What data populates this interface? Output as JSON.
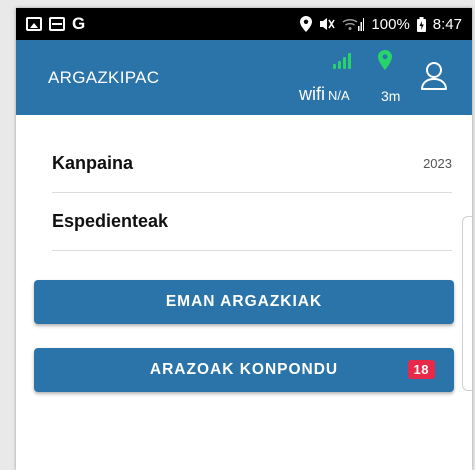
{
  "status_bar": {
    "left_icons": [
      "image-icon",
      "card-icon"
    ],
    "g_label": "G",
    "battery": "100%",
    "time": "8:47"
  },
  "header": {
    "app_title": "ARGAZKIPAC",
    "wifi_label": "wifi",
    "wifi_value": "N/A",
    "location_age": "3m",
    "signal_color": "#27d36b",
    "pin_color": "#27d36b"
  },
  "rows": [
    {
      "label": "Kanpaina",
      "value": "2023"
    },
    {
      "label": "Espedienteak",
      "value": ""
    }
  ],
  "buttons": {
    "take_photos": "EMAN ARGAZKIAK",
    "fix_issues": "ARAZOAK KONPONDU",
    "issues_count": "18"
  },
  "colors": {
    "accent": "#2a74a9",
    "badge": "#e8294a"
  }
}
